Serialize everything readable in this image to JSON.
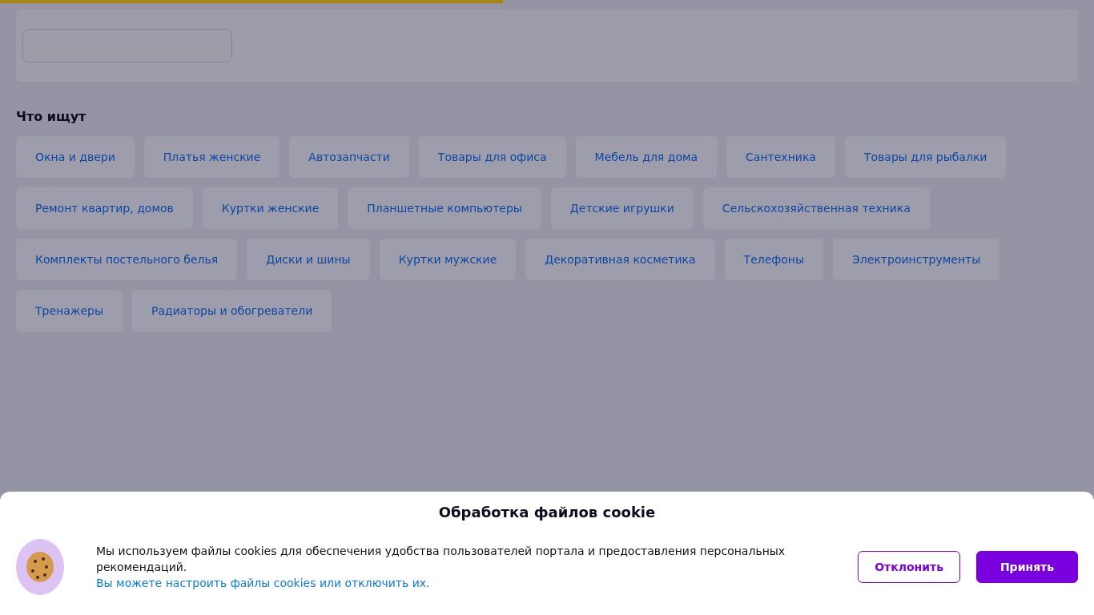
{
  "progress": {
    "level": 0.46
  },
  "popular": {
    "title": "Что ищут",
    "items": [
      "Окна и двери",
      "Платья женские",
      "Автозапчасти",
      "Товары для офиса",
      "Мебель для дома",
      "Сантехника",
      "Товары для рыбалки",
      "Ремонт квартир, домов",
      "Куртки женские",
      "Планшетные компьютеры",
      "Детские игрушки",
      "Сельскохозяйственная техника",
      "Комплекты постельного белья",
      "Диски и шины",
      "Куртки мужские",
      "Декоративная косметика",
      "Телефоны",
      "Электроинструменты",
      "Тренажеры",
      "Радиаторы и обогреватели"
    ]
  },
  "cookie_banner": {
    "title": "Обработка файлов cookie",
    "text": "Мы используем файлы cookies для обеспечения удобства пользователей портала и предоставления персональных рекомендаций.",
    "link": "Вы можете настроить файлы cookies или отключить их.",
    "buttons": [
      {
        "label": "Отклонить",
        "kind": "outline"
      },
      {
        "label": "Принять",
        "kind": "primary"
      }
    ]
  }
}
